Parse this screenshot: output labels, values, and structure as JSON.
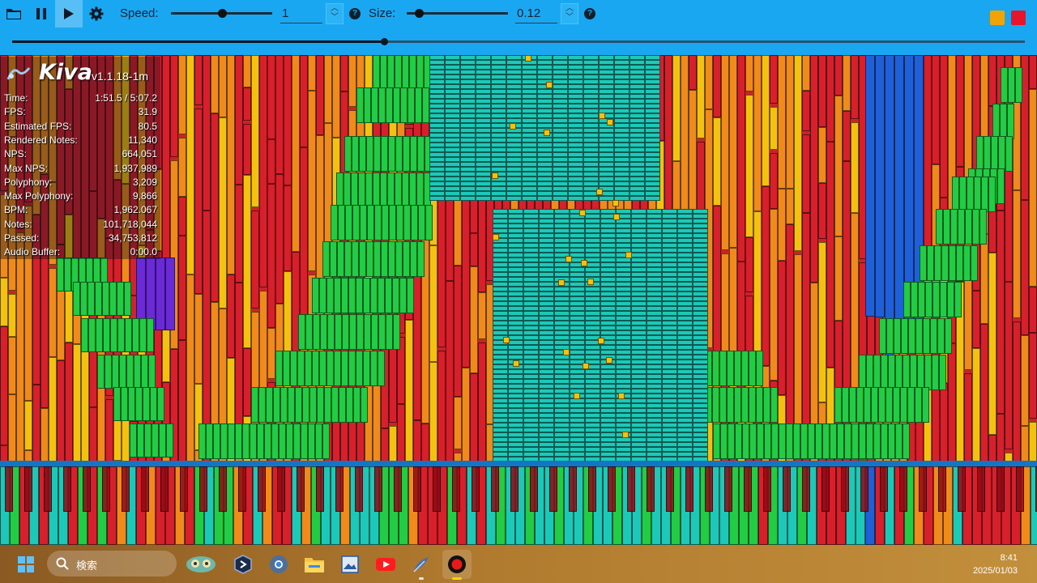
{
  "toolbar": {
    "open_icon": "folder-icon",
    "pause_icon": "pause-icon",
    "play_icon": "play-icon",
    "settings_icon": "gear-icon",
    "speed_label": "Speed:",
    "speed_value": "1",
    "speed_slider_position": 0.5,
    "size_label": "Size:",
    "size_value": "0.12",
    "size_slider_position": 0.12,
    "help_glyph": "?",
    "swatches": [
      "#f2a300",
      "#e8142b"
    ],
    "seek_progress": 0.367
  },
  "overlay": {
    "app_name": "Kiva",
    "version": "v1.1.18-1m",
    "stats": [
      {
        "label": "Time:",
        "value": "1:51.5 / 5:07.2"
      },
      {
        "label": "FPS:",
        "value": "31.9"
      },
      {
        "label": "Estimated FPS:",
        "value": "80.5"
      },
      {
        "label": "Rendered Notes:",
        "value": "11,340"
      },
      {
        "label": "NPS:",
        "value": "664,051"
      },
      {
        "label": "Max NPS:",
        "value": "1,937,989"
      },
      {
        "label": "Polyphony:",
        "value": "3,209"
      },
      {
        "label": "Max Polyphony:",
        "value": "9,866"
      },
      {
        "label": "BPM:",
        "value": "1,962.067"
      },
      {
        "label": "Notes:",
        "value": "101,718,044"
      },
      {
        "label": "Passed:",
        "value": "34,753,812"
      },
      {
        "label": "Audio Buffer:",
        "value": "0:00.0"
      }
    ]
  },
  "colors": {
    "toolbar_bg": "#1aa7f2",
    "red": "#d81f2c",
    "orange": "#f08a1a",
    "yellow": "#f4c10f",
    "green": "#22cc44",
    "cyan": "#1cc9b8",
    "blue": "#1f5fd8",
    "purple": "#6a2ad6",
    "judge_line": "#1276c8"
  },
  "taskbar": {
    "search_placeholder": "検索",
    "time": "8:41",
    "date": "2025/01/03",
    "apps": [
      "windows-start-icon",
      "search-icon",
      "widget-icon",
      "dev-app-icon",
      "chrome-icon",
      "file-explorer-icon",
      "photos-icon",
      "youtube-icon",
      "feather-app-icon",
      "recorder-icon"
    ]
  }
}
